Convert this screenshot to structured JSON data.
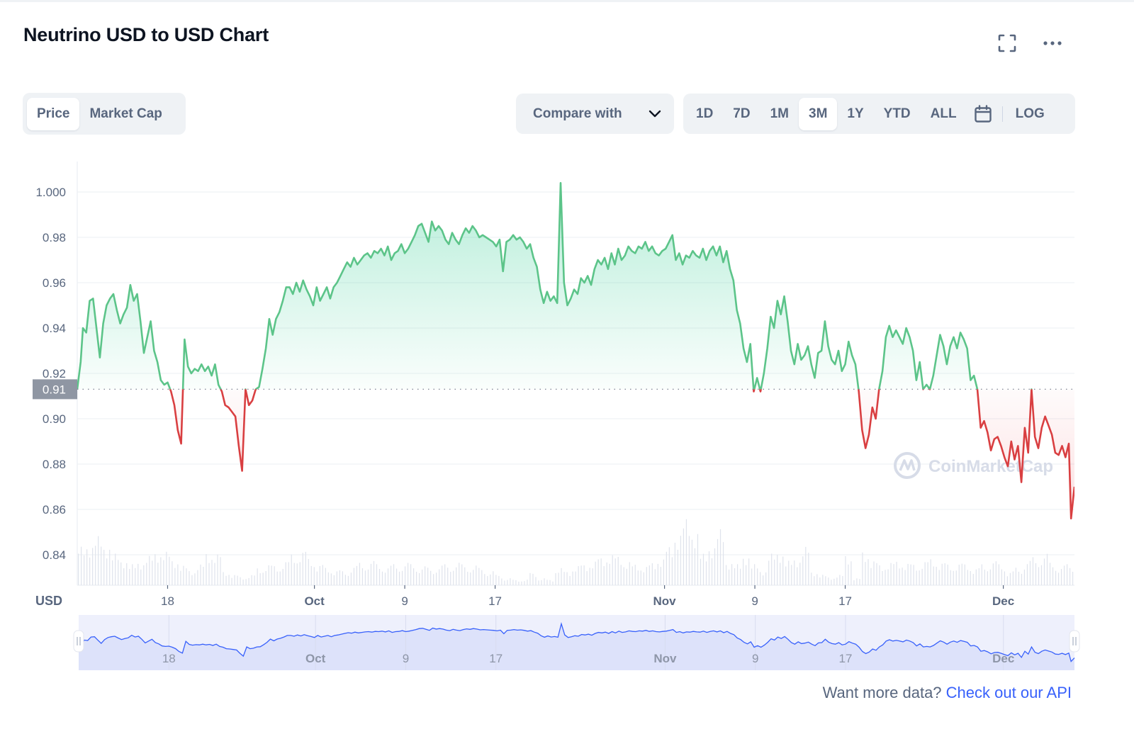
{
  "header": {
    "title": "Neutrino USD to USD Chart",
    "fullscreen_icon": "fullscreen-icon",
    "more_icon": "more-horizontal-icon"
  },
  "type_tabs": [
    {
      "label": "Price",
      "active": true
    },
    {
      "label": "Market Cap",
      "active": false
    }
  ],
  "compare": {
    "label": "Compare with",
    "icon": "chevron-down-icon"
  },
  "range_tabs": [
    {
      "label": "1D",
      "active": false
    },
    {
      "label": "7D",
      "active": false
    },
    {
      "label": "1M",
      "active": false
    },
    {
      "label": "3M",
      "active": true
    },
    {
      "label": "1Y",
      "active": false
    },
    {
      "label": "YTD",
      "active": false
    },
    {
      "label": "ALL",
      "active": false
    }
  ],
  "calendar_icon": "calendar-icon",
  "log_label": "LOG",
  "watermark": "CoinMarketCap",
  "footer": {
    "text": "Want more data?",
    "link": "Check out our API"
  },
  "colors": {
    "up": "#16c784",
    "up_line": "#5cc489",
    "down": "#d93f41",
    "navigator": "#3861fb",
    "link": "#3861fb"
  },
  "chart_data": {
    "type": "line",
    "title": "Neutrino USD to USD Chart",
    "xlabel": "",
    "ylabel": "USD",
    "currency_label": "USD",
    "ylim": [
      0.827,
      1.013
    ],
    "yticks": [
      "0.84",
      "0.86",
      "0.88",
      "0.90",
      "0.92",
      "0.94",
      "0.96",
      "0.98",
      "1.000"
    ],
    "ytick_values": [
      0.84,
      0.86,
      0.88,
      0.9,
      0.92,
      0.94,
      0.96,
      0.98,
      1.0
    ],
    "baseline": 0.913,
    "baseline_label": "0.91",
    "x_range_days": [
      0,
      88.3
    ],
    "xticks": [
      {
        "label": "18",
        "day": 8,
        "bold": false
      },
      {
        "label": "Oct",
        "day": 21,
        "bold": true
      },
      {
        "label": "9",
        "day": 29,
        "bold": false
      },
      {
        "label": "17",
        "day": 37,
        "bold": false
      },
      {
        "label": "Nov",
        "day": 52,
        "bold": true
      },
      {
        "label": "9",
        "day": 60,
        "bold": false
      },
      {
        "label": "17",
        "day": 68,
        "bold": false
      },
      {
        "label": "Dec",
        "day": 82,
        "bold": true
      }
    ],
    "price_series": {
      "name": "Price",
      "x": [
        0,
        0.3,
        0.5,
        0.8,
        1.1,
        1.4,
        1.7,
        2.0,
        2.3,
        2.6,
        2.9,
        3.2,
        3.5,
        3.8,
        4.1,
        4.4,
        4.7,
        5.0,
        5.3,
        5.6,
        5.9,
        6.2,
        6.5,
        6.8,
        7.1,
        7.4,
        7.7,
        8.0,
        8.3,
        8.6,
        8.9,
        9.2,
        9.5,
        9.8,
        10.1,
        10.4,
        10.7,
        11.0,
        11.3,
        11.6,
        11.9,
        12.2,
        12.5,
        12.8,
        13.1,
        13.4,
        13.7,
        14.0,
        14.3,
        14.6,
        14.9,
        15.2,
        15.5,
        15.8,
        16.1,
        16.4,
        16.7,
        17.0,
        17.3,
        17.6,
        17.9,
        18.2,
        18.5,
        18.8,
        19.1,
        19.4,
        19.7,
        20.0,
        20.3,
        20.6,
        20.9,
        21.2,
        21.5,
        21.8,
        22.1,
        22.4,
        22.7,
        23.0,
        23.3,
        23.6,
        23.9,
        24.2,
        24.5,
        24.8,
        25.1,
        25.4,
        25.7,
        26.0,
        26.3,
        26.6,
        26.9,
        27.2,
        27.5,
        27.8,
        28.1,
        28.4,
        28.7,
        29.0,
        29.3,
        29.6,
        29.9,
        30.2,
        30.5,
        30.8,
        31.1,
        31.4,
        31.7,
        32.0,
        32.3,
        32.6,
        32.9,
        33.2,
        33.5,
        33.8,
        34.1,
        34.4,
        34.7,
        35.0,
        35.3,
        35.6,
        35.9,
        36.2,
        36.5,
        36.8,
        37.1,
        37.4,
        37.7,
        38.0,
        38.3,
        38.6,
        38.9,
        39.2,
        39.5,
        39.8,
        40.1,
        40.4,
        40.7,
        41.0,
        41.3,
        41.6,
        41.9,
        42.2,
        42.5,
        42.8,
        43.1,
        43.4,
        43.7,
        44.0,
        44.3,
        44.6,
        44.9,
        45.2,
        45.5,
        45.8,
        46.1,
        46.4,
        46.7,
        47.0,
        47.3,
        47.6,
        47.9,
        48.2,
        48.5,
        48.8,
        49.1,
        49.4,
        49.7,
        50.0,
        50.3,
        50.6,
        50.9,
        51.2,
        51.5,
        51.8,
        52.1,
        52.4,
        52.7,
        53.0,
        53.3,
        53.6,
        53.9,
        54.2,
        54.5,
        54.8,
        55.1,
        55.4,
        55.7,
        56.0,
        56.3,
        56.6,
        56.9,
        57.2,
        57.5,
        57.8,
        58.1,
        58.4,
        58.7,
        59.0,
        59.3,
        59.6,
        59.9,
        60.2,
        60.5,
        60.8,
        61.1,
        61.4,
        61.7,
        62.0,
        62.3,
        62.6,
        62.9,
        63.2,
        63.5,
        63.8,
        64.1,
        64.4,
        64.7,
        65.0,
        65.3,
        65.6,
        65.9,
        66.2,
        66.5,
        66.8,
        67.1,
        67.4,
        67.7,
        68.0,
        68.3,
        68.6,
        68.9,
        69.2,
        69.5,
        69.8,
        70.1,
        70.4,
        70.7,
        71.0,
        71.3,
        71.6,
        71.9,
        72.2,
        72.5,
        72.8,
        73.1,
        73.4,
        73.7,
        74.0,
        74.3,
        74.6,
        74.9,
        75.2,
        75.5,
        75.8,
        76.1,
        76.4,
        76.7,
        77.0,
        77.3,
        77.6,
        77.9,
        78.2,
        78.5,
        78.8,
        79.1,
        79.4,
        79.7,
        80.0,
        80.3,
        80.6,
        80.9,
        81.2,
        81.5,
        81.8,
        82.1,
        82.4,
        82.7,
        83.0,
        83.3,
        83.6,
        83.9,
        84.2,
        84.5,
        84.8,
        85.1,
        85.4,
        85.7,
        86.0,
        86.3,
        86.6,
        86.9,
        87.2,
        87.5,
        87.8,
        88.0,
        88.3
      ],
      "y": [
        0.913,
        0.925,
        0.94,
        0.938,
        0.952,
        0.953,
        0.94,
        0.927,
        0.942,
        0.95,
        0.953,
        0.955,
        0.948,
        0.942,
        0.946,
        0.949,
        0.959,
        0.952,
        0.955,
        0.943,
        0.929,
        0.936,
        0.943,
        0.93,
        0.925,
        0.917,
        0.915,
        0.916,
        0.912,
        0.906,
        0.895,
        0.889,
        0.935,
        0.923,
        0.92,
        0.922,
        0.921,
        0.924,
        0.921,
        0.923,
        0.919,
        0.924,
        0.915,
        0.912,
        0.906,
        0.905,
        0.903,
        0.901,
        0.888,
        0.877,
        0.913,
        0.906,
        0.908,
        0.913,
        0.914,
        0.922,
        0.931,
        0.944,
        0.937,
        0.944,
        0.947,
        0.952,
        0.958,
        0.958,
        0.955,
        0.96,
        0.956,
        0.961,
        0.957,
        0.954,
        0.95,
        0.958,
        0.952,
        0.955,
        0.958,
        0.953,
        0.958,
        0.96,
        0.963,
        0.966,
        0.969,
        0.967,
        0.971,
        0.968,
        0.97,
        0.972,
        0.973,
        0.971,
        0.974,
        0.973,
        0.975,
        0.972,
        0.976,
        0.97,
        0.973,
        0.974,
        0.977,
        0.973,
        0.975,
        0.978,
        0.981,
        0.985,
        0.986,
        0.982,
        0.978,
        0.987,
        0.983,
        0.985,
        0.983,
        0.979,
        0.977,
        0.982,
        0.979,
        0.977,
        0.981,
        0.984,
        0.982,
        0.985,
        0.983,
        0.98,
        0.981,
        0.98,
        0.979,
        0.978,
        0.976,
        0.979,
        0.965,
        0.978,
        0.979,
        0.981,
        0.979,
        0.98,
        0.978,
        0.975,
        0.977,
        0.971,
        0.967,
        0.957,
        0.951,
        0.956,
        0.952,
        0.954,
        0.951,
        1.004,
        0.96,
        0.95,
        0.953,
        0.957,
        0.955,
        0.962,
        0.96,
        0.963,
        0.959,
        0.966,
        0.97,
        0.968,
        0.971,
        0.966,
        0.973,
        0.968,
        0.975,
        0.97,
        0.972,
        0.976,
        0.974,
        0.973,
        0.976,
        0.975,
        0.978,
        0.974,
        0.976,
        0.973,
        0.972,
        0.974,
        0.975,
        0.978,
        0.981,
        0.97,
        0.973,
        0.968,
        0.972,
        0.971,
        0.974,
        0.972,
        0.971,
        0.975,
        0.97,
        0.974,
        0.976,
        0.972,
        0.976,
        0.969,
        0.974,
        0.966,
        0.961,
        0.948,
        0.942,
        0.931,
        0.925,
        0.933,
        0.912,
        0.918,
        0.912,
        0.92,
        0.931,
        0.945,
        0.94,
        0.952,
        0.946,
        0.954,
        0.943,
        0.93,
        0.924,
        0.933,
        0.926,
        0.928,
        0.932,
        0.924,
        0.918,
        0.929,
        0.93,
        0.943,
        0.932,
        0.926,
        0.924,
        0.93,
        0.921,
        0.924,
        0.934,
        0.928,
        0.924,
        0.912,
        0.895,
        0.887,
        0.893,
        0.905,
        0.9,
        0.913,
        0.921,
        0.936,
        0.941,
        0.936,
        0.939,
        0.936,
        0.933,
        0.94,
        0.936,
        0.93,
        0.917,
        0.925,
        0.913,
        0.915,
        0.913,
        0.919,
        0.928,
        0.937,
        0.932,
        0.924,
        0.932,
        0.936,
        0.931,
        0.938,
        0.935,
        0.931,
        0.917,
        0.919,
        0.913,
        0.896,
        0.899,
        0.894,
        0.886,
        0.891,
        0.892,
        0.888,
        0.883,
        0.879,
        0.89,
        0.882,
        0.888,
        0.872,
        0.896,
        0.885,
        0.913,
        0.892,
        0.887,
        0.896,
        0.901,
        0.897,
        0.893,
        0.885,
        0.884,
        0.888,
        0.883,
        0.889,
        0.856,
        0.87
      ]
    },
    "volume_series": {
      "name": "Volume (relative)",
      "note": "unlabeled relative volume bars behind price line",
      "values": [
        0.55,
        0.62,
        0.7,
        0.6,
        0.45,
        0.38,
        0.3,
        0.35,
        0.42,
        0.5,
        0.48,
        0.38,
        0.28,
        0.22,
        0.3,
        0.48,
        0.45,
        0.2,
        0.15,
        0.12,
        0.15,
        0.25,
        0.3,
        0.28,
        0.35,
        0.45,
        0.5,
        0.38,
        0.3,
        0.25,
        0.22,
        0.2,
        0.28,
        0.32,
        0.35,
        0.3,
        0.28,
        0.3,
        0.32,
        0.3,
        0.27,
        0.25,
        0.28,
        0.3,
        0.32,
        0.3,
        0.28,
        0.25,
        0.2,
        0.15,
        0.1,
        0.08,
        0.08,
        0.18,
        0.1,
        0.08,
        0.25,
        0.2,
        0.28,
        0.3,
        0.35,
        0.4,
        0.45,
        0.42,
        0.35,
        0.3,
        0.28,
        0.32,
        0.4,
        0.55,
        0.78,
        0.95,
        0.82,
        0.45,
        0.6,
        0.8,
        0.35,
        0.3,
        0.45,
        0.3,
        0.22,
        0.45,
        0.5,
        0.35,
        0.4,
        0.55,
        0.2,
        0.15,
        0.12,
        0.15,
        0.45,
        0.1,
        0.5,
        0.35,
        0.3,
        0.33,
        0.35,
        0.32,
        0.3,
        0.35,
        0.38,
        0.33,
        0.3,
        0.32,
        0.3,
        0.25,
        0.3,
        0.35,
        0.3,
        0.2,
        0.25,
        0.35,
        0.4,
        0.45,
        0.32,
        0.28,
        0.3
      ]
    },
    "navigator": {
      "xticks": [
        "18",
        "Oct",
        "9",
        "17",
        "Nov",
        "9",
        "17",
        "Dec"
      ]
    }
  }
}
